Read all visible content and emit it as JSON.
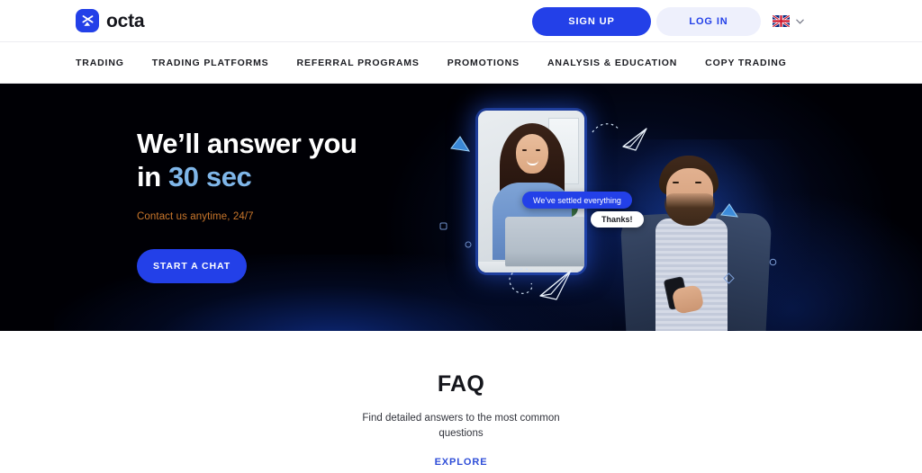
{
  "brand": {
    "name": "octa",
    "logo_icon": "octa-x-logo-icon",
    "accent_blue": "#2340E8",
    "light_blue": "#7FB6E9",
    "orange": "#C9762B"
  },
  "topbar": {
    "signup_label": "SIGN UP",
    "login_label": "LOG IN",
    "language_flag": "uk-flag-icon",
    "language_chevron": "chevron-down-icon"
  },
  "nav": {
    "items": [
      {
        "label": "TRADING"
      },
      {
        "label": "TRADING PLATFORMS"
      },
      {
        "label": "REFERRAL PROGRAMS"
      },
      {
        "label": "PROMOTIONS"
      },
      {
        "label": "ANALYSIS & EDUCATION"
      },
      {
        "label": "COPY TRADING"
      }
    ]
  },
  "hero": {
    "heading_line1": "We’ll answer you",
    "heading_line2_prefix": "in ",
    "heading_line2_accent": "30 sec",
    "subtitle": "Contact us anytime, 24/7",
    "cta_label": "START A CHAT",
    "chat_bubble_agent": "We’ve settled everything",
    "chat_bubble_user": "Thanks!",
    "decor": {
      "triangle_left": "triangle-icon",
      "triangle_right": "triangle-icon",
      "square_outline": "square-outline-icon",
      "circle_outline": "circle-outline-icon",
      "diamond_outline": "diamond-outline-icon",
      "paper_plane_top": "paper-plane-icon",
      "paper_plane_bottom": "paper-plane-icon"
    }
  },
  "faq": {
    "title": "FAQ",
    "description": "Find detailed answers to the most common questions",
    "link_label": "EXPLORE"
  }
}
